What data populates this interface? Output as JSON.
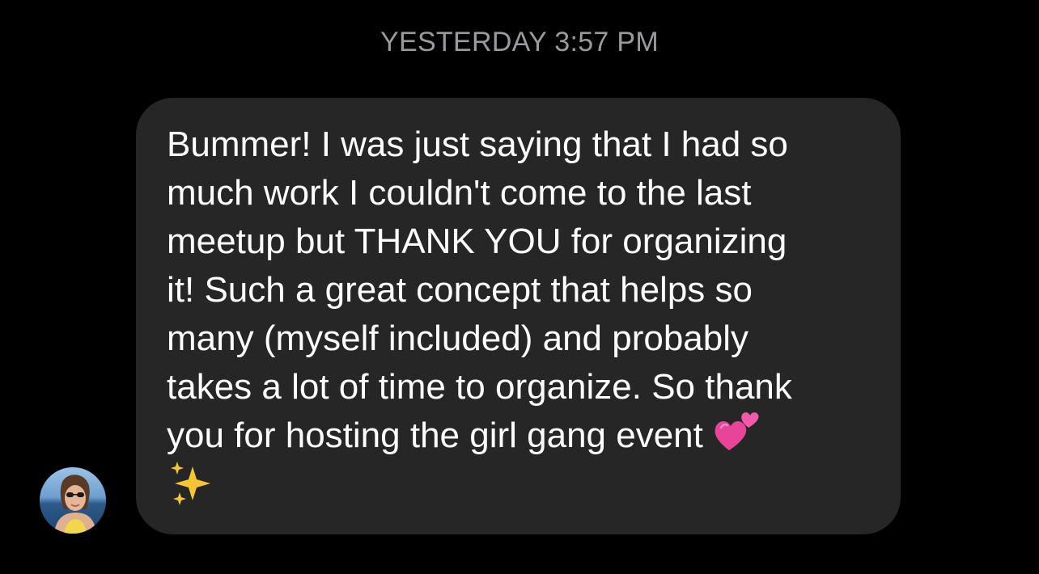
{
  "thread": {
    "timestamp": "YESTERDAY 3:57 PM"
  },
  "message": {
    "sender_avatar": "sender-avatar-photo",
    "text": "Bummer! I was just saying that I had so\nmuch work I couldn't come to the last\nmeetup but THANK YOU for organizing\nit! Such a great concept that helps so\nmany (myself included) and probably\ntakes a lot of time to organize. So thank\nyou for hosting the girl gang event",
    "emojis": [
      "two-hearts-icon",
      "sparkles-icon"
    ]
  },
  "colors": {
    "background": "#000000",
    "bubble": "#262626",
    "text": "#ffffff",
    "timestamp": "#9a9a9f"
  }
}
